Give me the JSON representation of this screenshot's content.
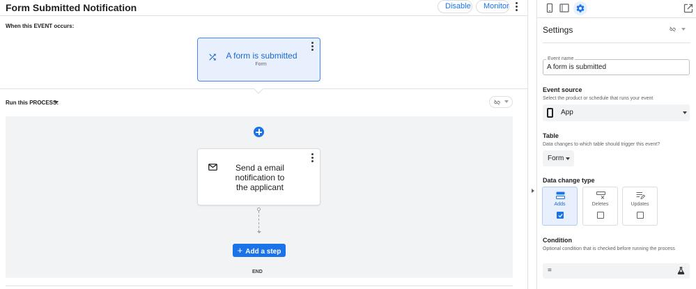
{
  "header": {
    "title": "Form Submitted Notification",
    "disable_label": "Disable",
    "monitor_label": "Monitor"
  },
  "event_section": {
    "label": "When this EVENT occurs:",
    "card_title": "A form is submitted",
    "card_subtitle": "Form"
  },
  "process_section": {
    "label": "Run this PROCESS:",
    "step_text": "Send a email notification to the applicant",
    "add_step_label": "Add a step",
    "end_label": "END"
  },
  "settings": {
    "title": "Settings",
    "event_name_label": "Event name",
    "event_name_value": "A form is submitted",
    "event_source_title": "Event source",
    "event_source_desc": "Select the product or schedule that runs your event",
    "event_source_value": "App",
    "table_title": "Table",
    "table_desc": "Data changes to which table should trigger this event?",
    "table_value": "Form",
    "data_change_title": "Data change type",
    "data_change_options": [
      {
        "label": "Adds",
        "checked": true
      },
      {
        "label": "Deletes",
        "checked": false
      },
      {
        "label": "Updates",
        "checked": false
      }
    ],
    "condition_title": "Condition",
    "condition_desc": "Optional condition that is checked before running the process",
    "condition_value": "="
  },
  "icons": {
    "tabs": [
      "phone-icon",
      "tablet-icon",
      "gear-icon"
    ],
    "popout": "open-in-new-icon"
  },
  "colors": {
    "accent": "#1a73e8",
    "event_card_bg": "#e8f0fe",
    "process_bg": "#f1f3f4"
  }
}
